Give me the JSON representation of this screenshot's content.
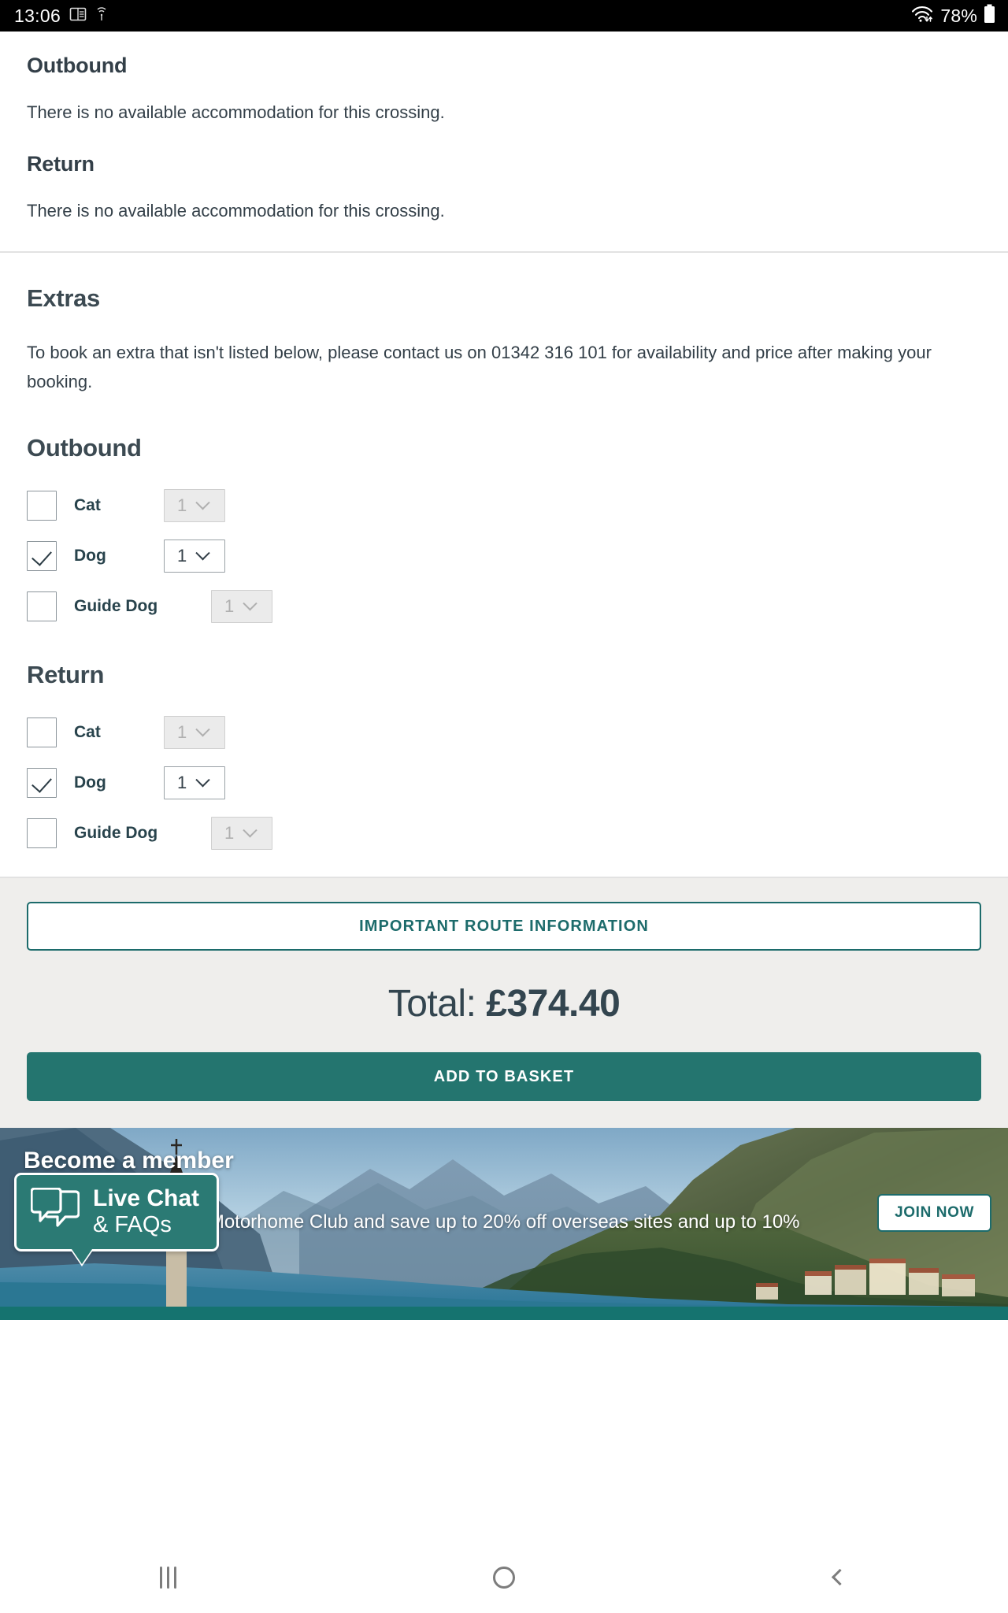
{
  "status_bar": {
    "time": "13:06",
    "icons": [
      "split-screen-icon",
      "wifi-calling-icon"
    ],
    "wifi_icon": "wifi-icon",
    "battery_percent": "78%",
    "battery_icon": "battery-icon"
  },
  "accommodation": {
    "outbound_heading": "Outbound",
    "outbound_text": "There is no available accommodation for this crossing.",
    "return_heading": "Return",
    "return_text": "There is no available accommodation for this crossing."
  },
  "extras": {
    "heading": "Extras",
    "intro": "To book an extra that isn't listed below, please contact us on 01342 316 101 for availability and price after making your booking.",
    "groups": [
      {
        "heading": "Outbound",
        "rows": [
          {
            "label": "Cat",
            "checked": false,
            "quantity": "1",
            "disabled": true
          },
          {
            "label": "Dog",
            "checked": true,
            "quantity": "1",
            "disabled": false
          },
          {
            "label": "Guide Dog",
            "checked": false,
            "quantity": "1",
            "disabled": true
          }
        ]
      },
      {
        "heading": "Return",
        "rows": [
          {
            "label": "Cat",
            "checked": false,
            "quantity": "1",
            "disabled": true
          },
          {
            "label": "Dog",
            "checked": true,
            "quantity": "1",
            "disabled": false
          },
          {
            "label": "Guide Dog",
            "checked": false,
            "quantity": "1",
            "disabled": true
          }
        ]
      }
    ]
  },
  "summary": {
    "route_info_label": "IMPORTANT ROUTE INFORMATION",
    "total_label": "Total: ",
    "total_value": "£374.40",
    "add_to_basket_label": "ADD TO BASKET"
  },
  "banner": {
    "title": "Become a member",
    "subtitle": "Join the Caravan and Motorhome Club and save up to 20% off overseas sites and up to 10%",
    "join_label": "JOIN NOW"
  },
  "live_chat": {
    "line1": "Live Chat",
    "line2": "& FAQs",
    "icon": "chat-bubbles-icon"
  },
  "nav_bar": {
    "recents": "recent-apps-icon",
    "home": "home-icon",
    "back": "back-icon"
  },
  "colors": {
    "teal": "#24756f",
    "teal_dark": "#1c6b6b",
    "text_dark": "#333f48",
    "label_teal": "#28434c",
    "grey_bg": "#efeeec"
  }
}
